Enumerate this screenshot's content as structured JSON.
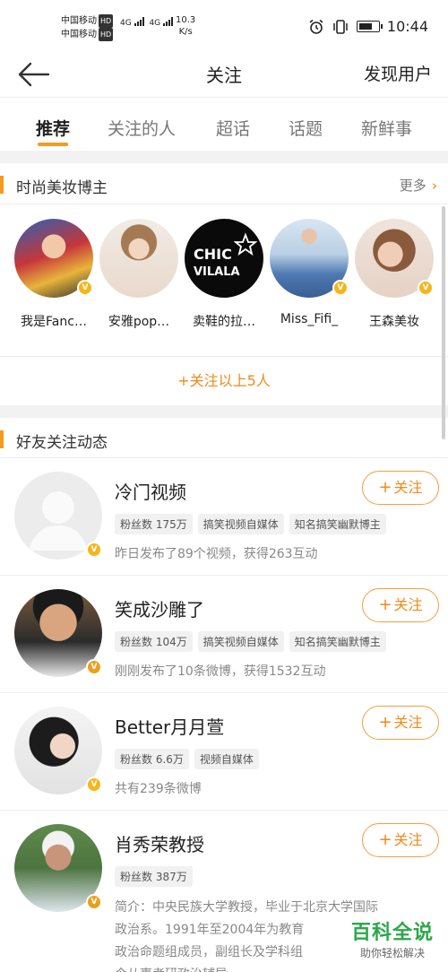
{
  "status_bar": {
    "carrier_1": "中国移动",
    "carrier_2": "中国移动",
    "hd": "HD",
    "network_1": "4G",
    "network_2": "4G",
    "speed_value": "10.3",
    "speed_unit": "K/s",
    "time": "10:44"
  },
  "nav": {
    "title": "关注",
    "discover": "发现用户"
  },
  "tabs": [
    {
      "label": "推荐",
      "active": true
    },
    {
      "label": "关注的人",
      "active": false
    },
    {
      "label": "超话",
      "active": false
    },
    {
      "label": "话题",
      "active": false
    },
    {
      "label": "新鲜事",
      "active": false
    }
  ],
  "bloggers_section": {
    "title": "时尚美妆博主",
    "more": "更多",
    "items": [
      {
        "name": "我是Fanc…",
        "verified": true
      },
      {
        "name": "安雅pop…",
        "verified": false
      },
      {
        "name": "卖鞋的拉…",
        "verified": false,
        "logo_line1": "CHIC",
        "logo_line2": "VILALA"
      },
      {
        "name": "Miss_Fifi_",
        "verified": true
      },
      {
        "name": "王森美妆",
        "verified": true
      }
    ],
    "follow_all": "+关注以上5人"
  },
  "friends_section": {
    "title": "好友关注动态",
    "users": [
      {
        "name": "冷门视频",
        "tags": [
          "粉丝数 175万",
          "搞笑视频自媒体",
          "知名搞笑幽默博主"
        ],
        "desc": "昨日发布了89个视频，获得263互动",
        "follow": "关注"
      },
      {
        "name": "笑成沙雕了",
        "tags": [
          "粉丝数 104万",
          "搞笑视频自媒体",
          "知名搞笑幽默博主"
        ],
        "desc": "刚刚发布了10条微博，获得1532互动",
        "follow": "关注"
      },
      {
        "name": "Better月月萱",
        "tags": [
          "粉丝数 6.6万",
          "视频自媒体"
        ],
        "desc": "共有239条微博",
        "follow": "关注"
      },
      {
        "name": "肖秀荣教授",
        "tags": [
          "粉丝数 387万"
        ],
        "desc_lines": [
          "简介：中央民族大学教授，毕业于北京大学国际",
          "政治系。1991年至2004年为教育",
          "政治命题组成员，副组长及学科组",
          "今从事考研政治辅导。"
        ],
        "follow": "关注"
      }
    ]
  },
  "watermark": {
    "title": "百科全说",
    "subtitle": "助你轻松解决"
  },
  "colors": {
    "accent": "#f79a1e",
    "follow_text": "#f08a1a",
    "watermark_green": "#2ba84a"
  }
}
